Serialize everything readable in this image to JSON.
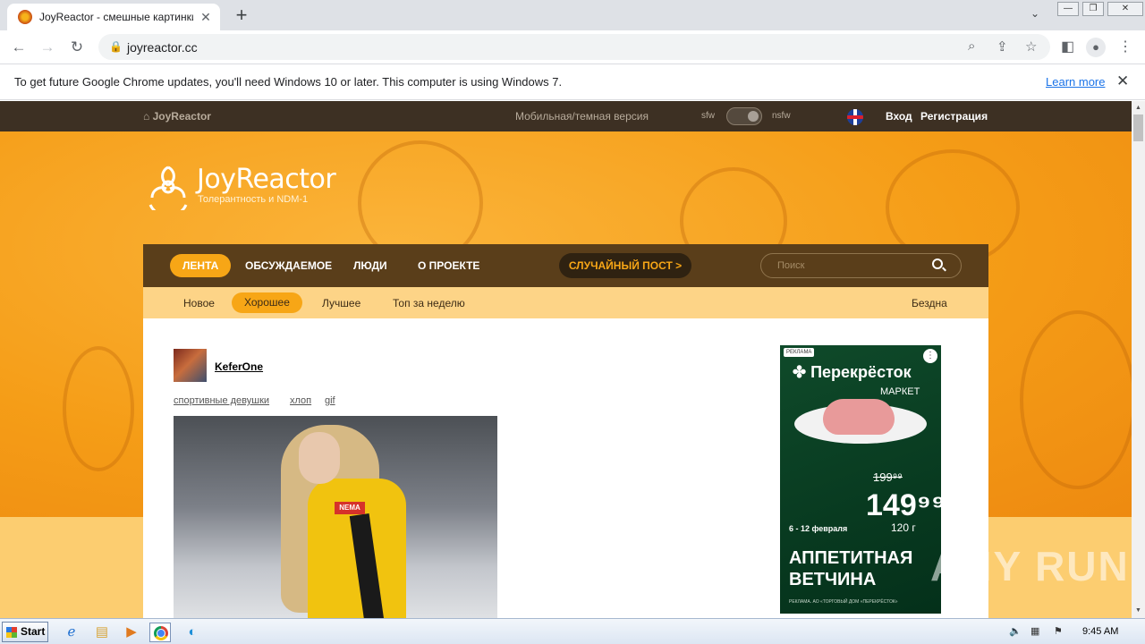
{
  "browser": {
    "tab_title": "JoyReactor - смешные картинки и",
    "tab_close": "✕",
    "new_tab": "+",
    "tab_search": "⌄",
    "url": "joyreactor.cc",
    "window_controls": {
      "minimize": "—",
      "restore": "❐",
      "close": "✕"
    }
  },
  "infobar": {
    "message": "To get future Google Chrome updates, you'll need Windows 10 or later. This computer is using Windows 7.",
    "link": "Learn more",
    "close": "✕"
  },
  "site": {
    "topbar": {
      "home": "JoyReactor",
      "mobile_link": "Мобильная/темная версия",
      "sfw": "sfw",
      "nsfw": "nsfw",
      "login": "Вход",
      "register": "Регистрация"
    },
    "logo": {
      "title": "JoyReactor",
      "subtitle": "Толерантность и NDM-1"
    },
    "mainnav": {
      "feed": "ЛЕНТА",
      "discussed": "ОБСУЖДАЕМОЕ",
      "people": "ЛЮДИ",
      "about": "О ПРОЕКТЕ",
      "random": "СЛУЧАЙНЫЙ ПОСТ >",
      "search_placeholder": "Поиск"
    },
    "subnav": {
      "new": "Новое",
      "good": "Хорошее",
      "best": "Лучшее",
      "top_week": "Топ за неделю",
      "abyss": "Бездна"
    },
    "post": {
      "author": "KeferOne",
      "tags": [
        "спортивные девушки",
        "хлоп",
        "gif"
      ],
      "image_badge": "NEMA"
    },
    "ad": {
      "label": "РЕКЛАМА",
      "more": "⋮",
      "brand": "Перекрёсток",
      "market": "МАРКЕТ",
      "old_price": "199⁹⁹",
      "price": "149⁹⁹",
      "date": "6 - 12 февраля",
      "weight": "120 г",
      "title": "АППЕТИТНАЯ ВЕТЧИНА",
      "fine_print": "РЕКЛАМА. АО «ТОРГОВЫЙ ДОМ «ПЕРЕКРЁСТОК»"
    },
    "watermark": "ANY RUN"
  },
  "taskbar": {
    "start": "Start",
    "clock": "9:45 AM"
  },
  "colors": {
    "brand_orange": "#f7a616",
    "nav_brown": "#5a3e1a",
    "topbar_dark": "#3d3023",
    "link_blue": "#1a73e8"
  }
}
